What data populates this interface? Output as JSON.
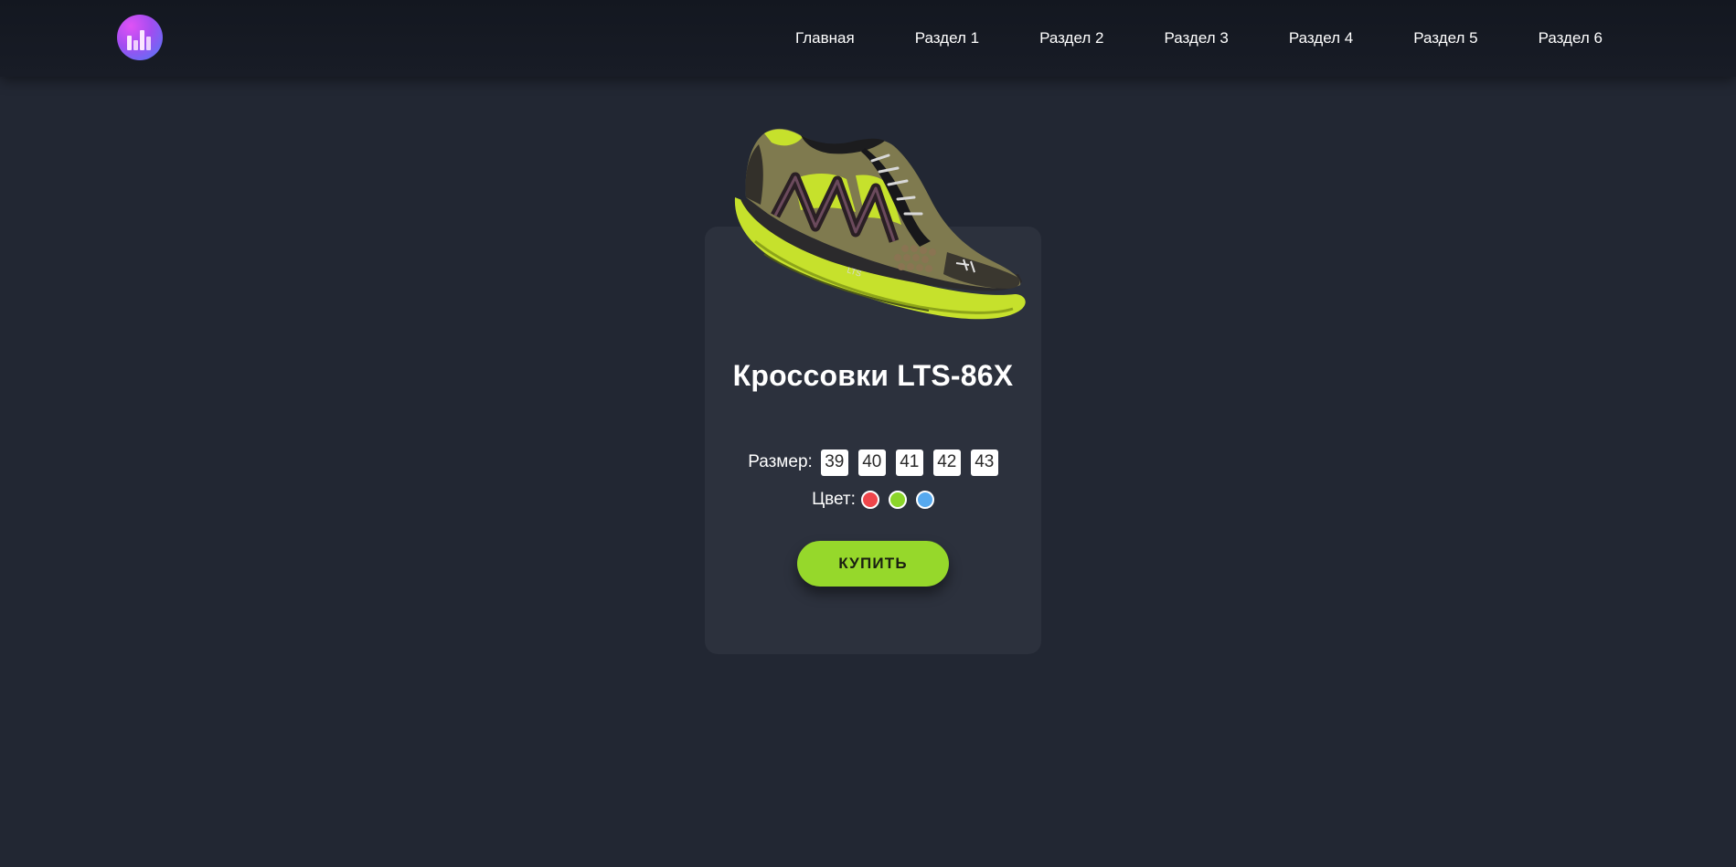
{
  "header": {
    "logo_icon": "bar-chart-logo-icon",
    "nav": [
      {
        "label": "Главная"
      },
      {
        "label": "Раздел 1"
      },
      {
        "label": "Раздел 2"
      },
      {
        "label": "Раздел 3"
      },
      {
        "label": "Раздел 4"
      },
      {
        "label": "Раздел 5"
      },
      {
        "label": "Раздел 6"
      }
    ]
  },
  "product": {
    "image_icon": "sneaker-image",
    "title": "Кроссовки LTS-86X",
    "size_label": "Размер:",
    "sizes": [
      "39",
      "40",
      "41",
      "42",
      "43"
    ],
    "color_label": "Цвет:",
    "colors": [
      "#f0464b",
      "#8bd52a",
      "#56a9ef"
    ],
    "buy_label": "КУПИТЬ"
  },
  "theme": {
    "background": "#222733",
    "card": "#2c313d",
    "accent": "#96d82b"
  }
}
